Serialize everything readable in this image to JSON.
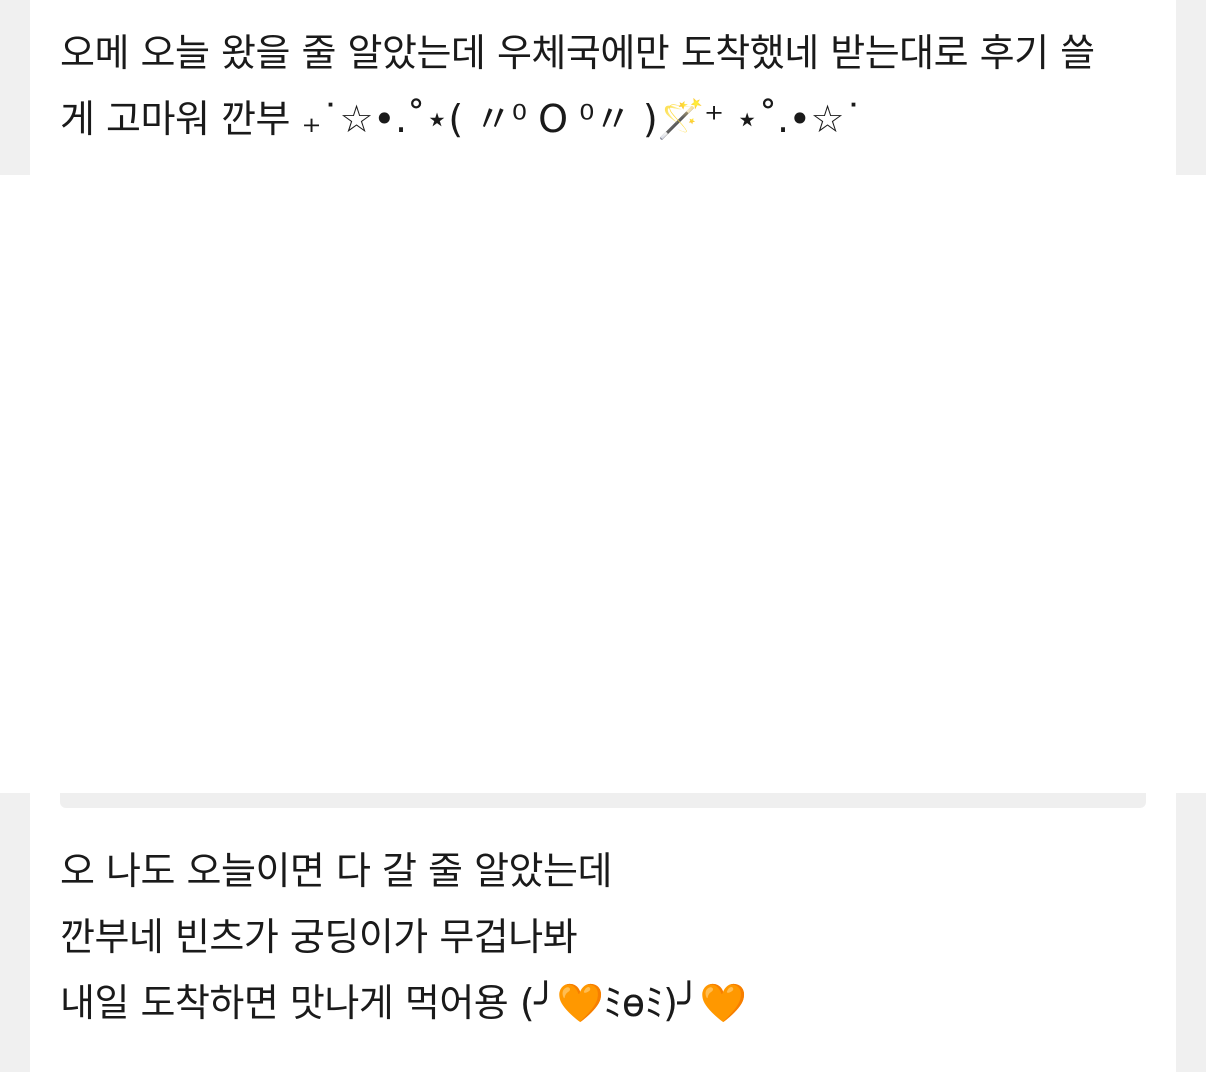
{
  "message_top": {
    "lines": [
      "오메 오늘 왔을 줄 알았는데 우체국에만 도착했네 받는대로 후기 쓸",
      "게 고마워 깐부 ₊˙☆•.˚⋆( 〃⁰ O ⁰〃 )🪄⁺ ⋆˚.•☆˙"
    ]
  },
  "message_bottom": {
    "lines": [
      "오 나도 오늘이면 다 갈 줄 알았는데",
      "깐부네 빈츠가 궁딩이가 무겁나봐",
      "내일 도착하면 맛나게 먹어용 (╯🧡ﾐɵﾐ)╯🧡"
    ]
  },
  "colors": {
    "side_background": "#f0f0f0",
    "card_background": "#ffffff",
    "text": "#1a1a1a",
    "heart": "#ff8a00"
  }
}
